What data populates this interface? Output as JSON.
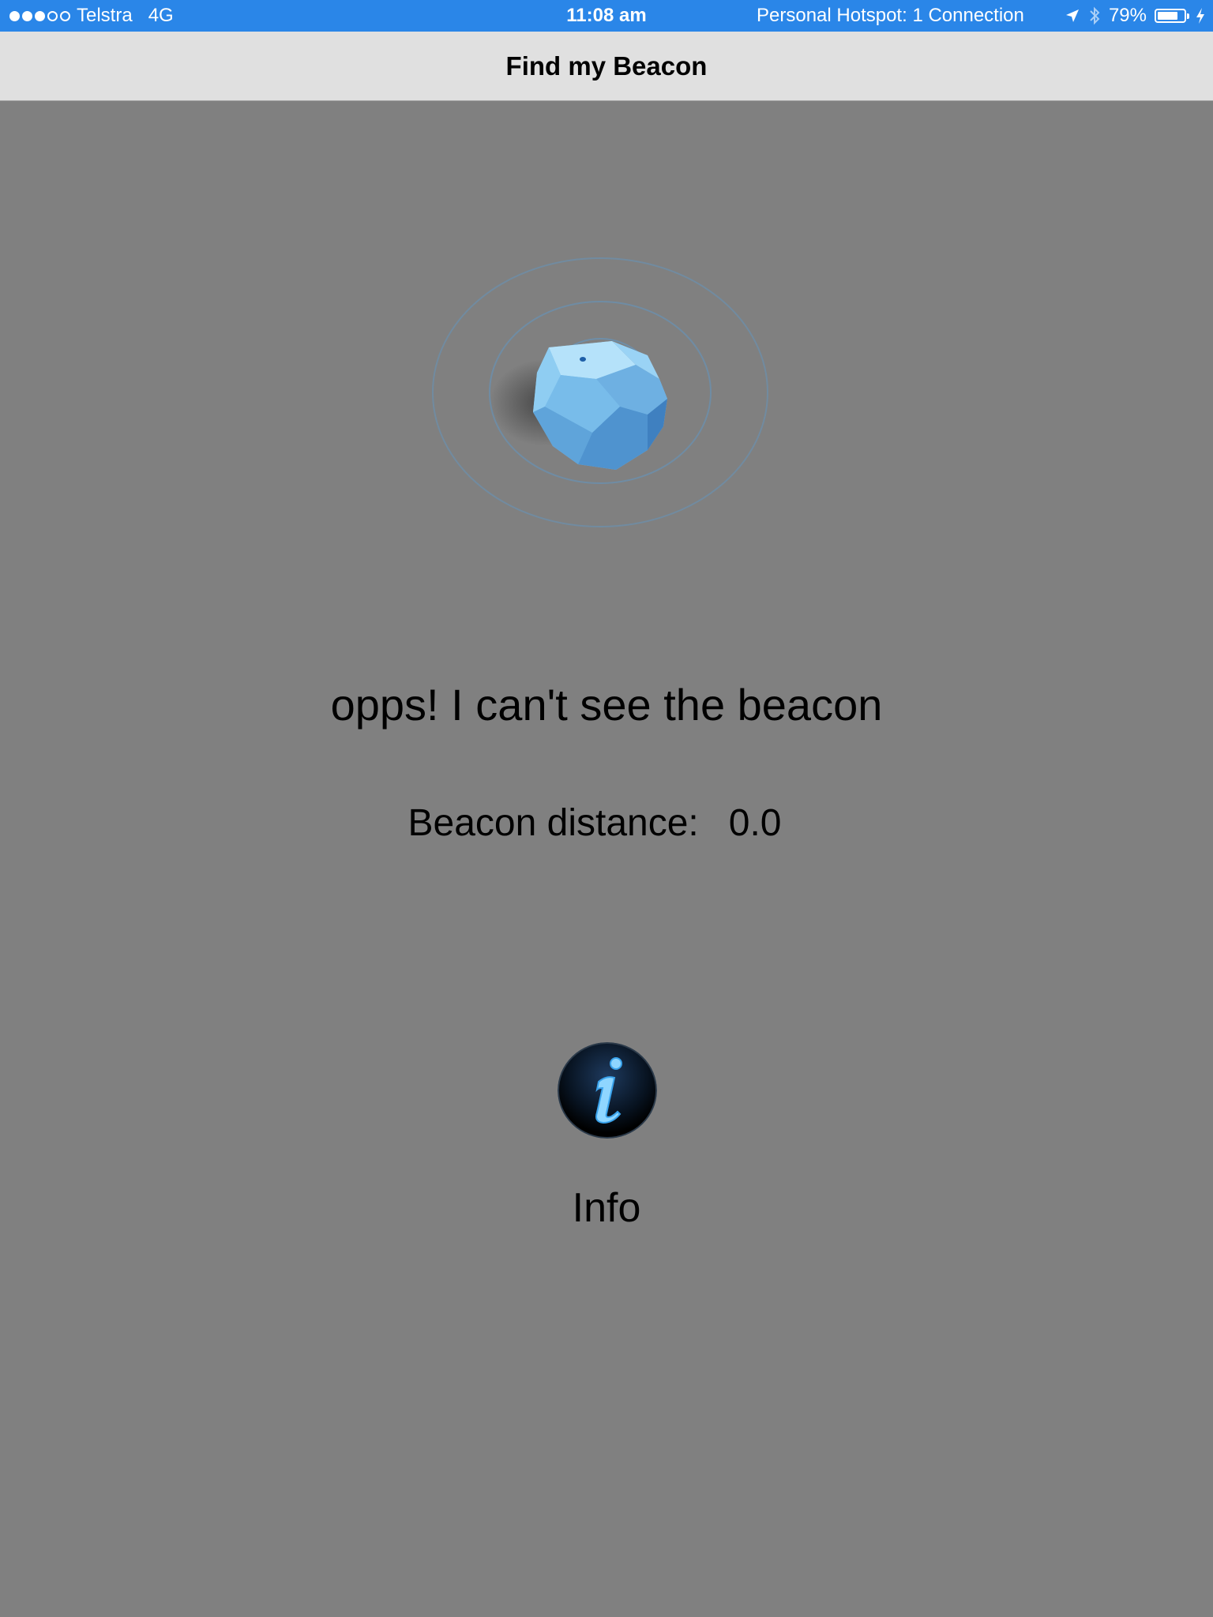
{
  "status_bar": {
    "signal_strength": 3,
    "signal_total": 5,
    "carrier": "Telstra",
    "network": "4G",
    "time": "11:08 am",
    "hotspot": "Personal Hotspot: 1 Connection",
    "battery_percent": "79%",
    "battery_level": 0.79,
    "icons": [
      "location-arrow-icon",
      "bluetooth-icon",
      "battery-icon",
      "charging-bolt-icon"
    ],
    "background_color": "#2a86e8"
  },
  "nav": {
    "title": "Find my Beacon"
  },
  "main": {
    "status_message": "opps! I can't see the beacon",
    "distance_label": "Beacon distance:",
    "distance_value": "0.0",
    "info_label": "Info",
    "background_color": "#808080",
    "beacon_color": "#6fb5e8"
  }
}
